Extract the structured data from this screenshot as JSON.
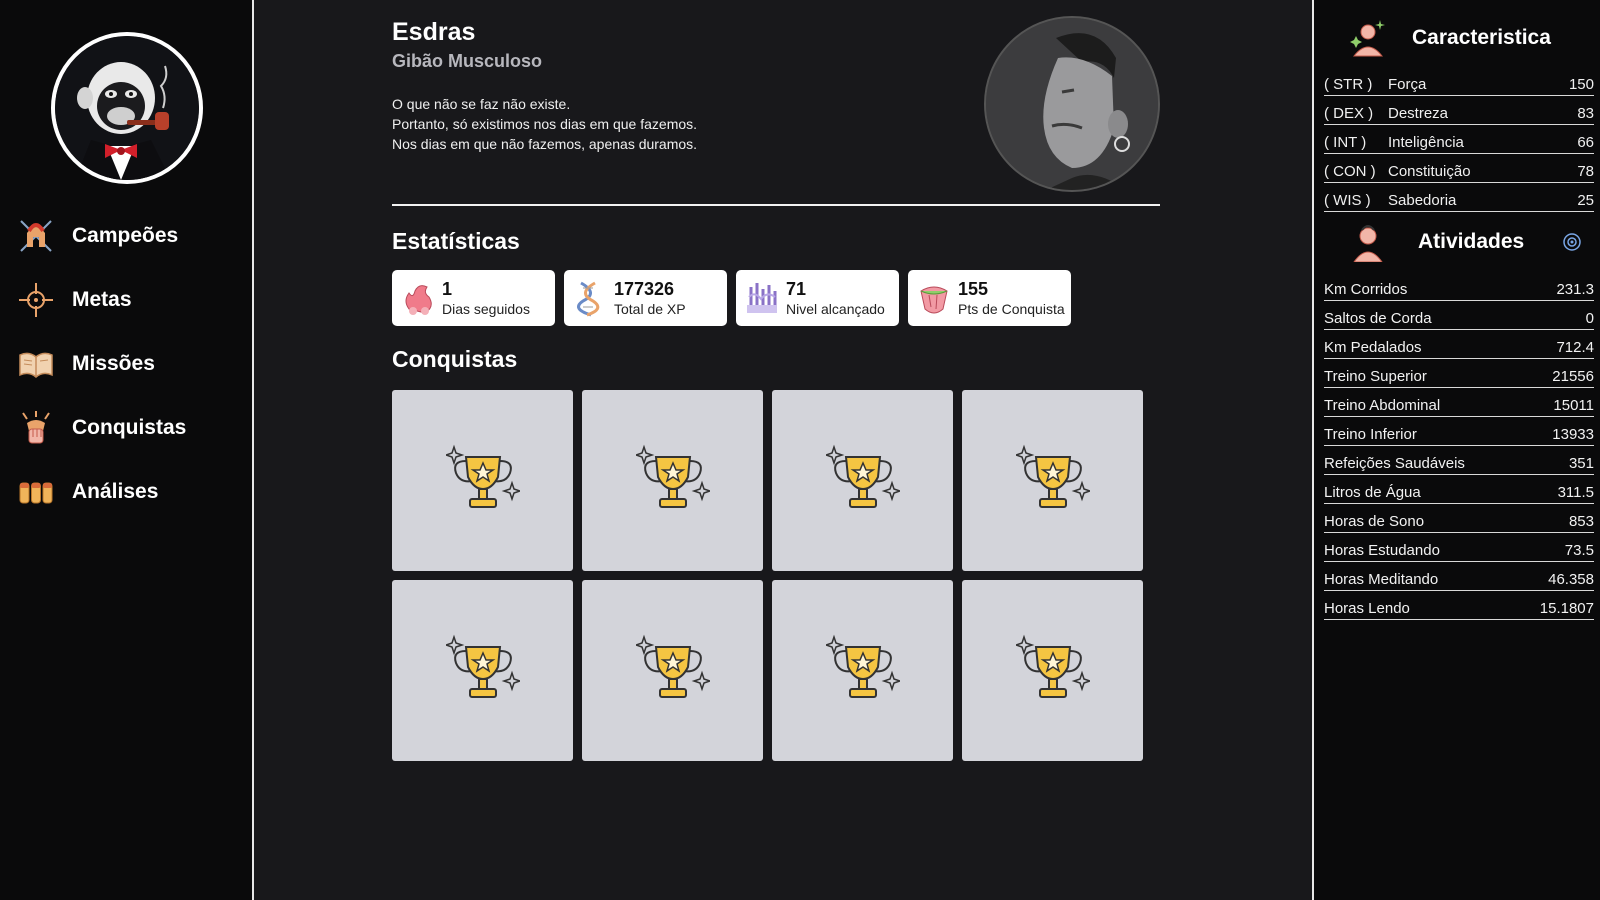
{
  "colors": {
    "background": "#18181b",
    "sidebar": "#0a0a0b",
    "card": "#ffffff",
    "tile": "#d3d4da",
    "trophy": "#f5c542"
  },
  "sidebar": {
    "logo_icon": "monkey-with-pipe-logo",
    "items": [
      {
        "label": "Campeões",
        "icon": "spartan-helmet-icon"
      },
      {
        "label": "Metas",
        "icon": "crosshair-icon"
      },
      {
        "label": "Missões",
        "icon": "open-book-icon"
      },
      {
        "label": "Conquistas",
        "icon": "trophy-hand-icon"
      },
      {
        "label": "Análises",
        "icon": "bars-icon"
      }
    ]
  },
  "profile": {
    "name": "Esdras",
    "title": "Gibão Musculoso",
    "motto": [
      "O que não se faz não existe.",
      "Portanto, só existimos nos dias em que fazemos.",
      "Nos dias em que não fazemos, apenas duramos."
    ],
    "avatar_icon": "user-photo-avatar"
  },
  "stats": {
    "title": "Estatísticas",
    "items": [
      {
        "value": "1",
        "label": "Dias seguidos",
        "icon": "fire-heart-icon"
      },
      {
        "value": "177326",
        "label": "Total de XP",
        "icon": "dna-icon"
      },
      {
        "value": "71",
        "label": "Nivel alcançado",
        "icon": "level-glyph-icon"
      },
      {
        "value": "155",
        "label": "Pts de Conquista",
        "icon": "gem-icon"
      }
    ]
  },
  "achievements": {
    "title": "Conquistas",
    "tiles": [
      "trophy-icon",
      "trophy-icon",
      "trophy-icon",
      "trophy-icon",
      "trophy-icon",
      "trophy-icon",
      "trophy-icon",
      "trophy-icon"
    ]
  },
  "attributes": {
    "title": "Caracteristica",
    "icon": "character-sparkle-icon",
    "items": [
      {
        "abbr": "( STR )",
        "name": "Força",
        "value": "150"
      },
      {
        "abbr": "( DEX )",
        "name": "Destreza",
        "value": "83"
      },
      {
        "abbr": "( INT )",
        "name": "Inteligência",
        "value": "66"
      },
      {
        "abbr": "( CON )",
        "name": "Constituição",
        "value": "78"
      },
      {
        "abbr": "( WIS )",
        "name": "Sabedoria",
        "value": "25"
      }
    ]
  },
  "activities": {
    "title": "Atividades",
    "icon": "person-icon",
    "action_icon": "target-settings-icon",
    "items": [
      {
        "name": "Km Corridos",
        "value": "231.3"
      },
      {
        "name": "Saltos de Corda",
        "value": "0"
      },
      {
        "name": "Km Pedalados",
        "value": "712.4"
      },
      {
        "name": "Treino Superior",
        "value": "21556"
      },
      {
        "name": "Treino Abdominal",
        "value": "15011"
      },
      {
        "name": "Treino Inferior",
        "value": "13933"
      },
      {
        "name": "Refeições Saudáveis",
        "value": "351"
      },
      {
        "name": "Litros de Água",
        "value": "311.5"
      },
      {
        "name": "Horas de Sono",
        "value": "853"
      },
      {
        "name": "Horas Estudando",
        "value": "73.5"
      },
      {
        "name": "Horas Meditando",
        "value": "46.358"
      },
      {
        "name": "Horas Lendo",
        "value": "15.1807"
      }
    ]
  }
}
